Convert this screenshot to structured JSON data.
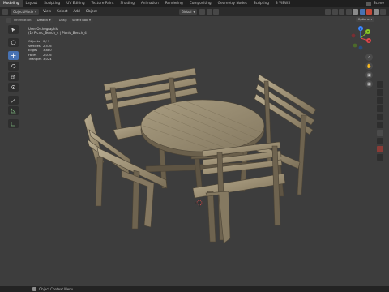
{
  "workspace_tabs": [
    "Modeling",
    "Layout",
    "Sculpting",
    "UV Editing",
    "Texture Paint",
    "Shading",
    "Animation",
    "Rendering",
    "Compositing",
    "Geometry Nodes",
    "Scripting",
    "3 VIEWS"
  ],
  "active_workspace": "Modeling",
  "topbar_right": {
    "scene_label": "Scene"
  },
  "header": {
    "mode": "Object Mode",
    "menus": [
      "View",
      "Select",
      "Add",
      "Object"
    ],
    "transform_orientation": "Global"
  },
  "subheader": {
    "orientation_label": "Orientation:",
    "orientation_value": "Default",
    "drag_label": "Drag:",
    "drag_value": "Select Box",
    "options_label": "Options"
  },
  "overlay": {
    "view_name": "User Orthographic",
    "object_name": "(1) Picnic_Bench_4 | Picnic_Bench_4"
  },
  "stats": [
    {
      "key": "Objects",
      "value": "0 / 1"
    },
    {
      "key": "Vertices",
      "value": "2,576"
    },
    {
      "key": "Edges",
      "value": "3,880"
    },
    {
      "key": "Faces",
      "value": "2,076"
    },
    {
      "key": "Triangles",
      "value": "3,024"
    }
  ],
  "gizmo": {
    "x_label": "X",
    "y_label": "Y",
    "z_label": "Z"
  },
  "status_bar": {
    "hint": "Object Context Menu"
  },
  "colors": {
    "viewport_bg": "#3d3d3d",
    "accent": "#4772b3",
    "wood_light": "#b7ab8e",
    "wood_mid": "#8d8066",
    "wood_dark": "#5e5443"
  },
  "left_tools": [
    "cursor-select-tool",
    "cursor-3d-tool",
    "move-tool",
    "rotate-tool",
    "scale-tool",
    "transform-tool",
    "annotate-tool",
    "measure-tool",
    "add-cube-tool"
  ]
}
